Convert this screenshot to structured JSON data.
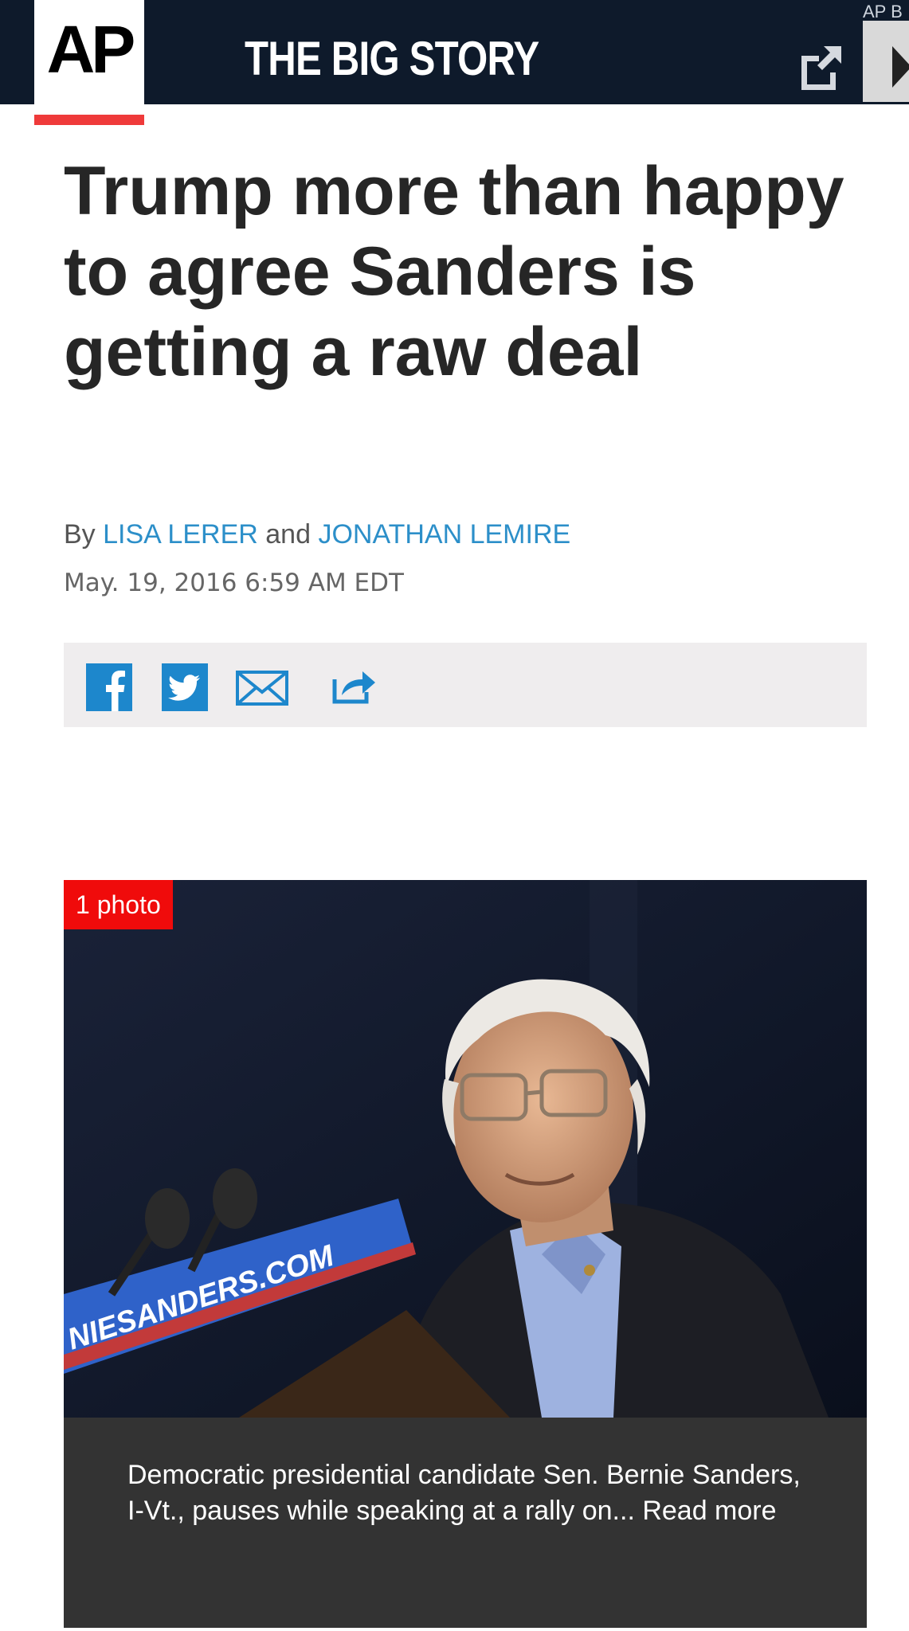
{
  "header": {
    "logo_text": "AP",
    "brand_title": "THE BIG STORY",
    "corner_text": "AP B",
    "external_link_icon": "external-link-icon",
    "play_icon": "play-icon"
  },
  "article": {
    "headline": "Trump more than happy to agree Sanders is getting a raw deal",
    "byline_prefix": "By",
    "authors": [
      "LISA LERER",
      "JONATHAN LEMIRE"
    ],
    "byline_joiner": "and",
    "date": "May. 19, 2016 6:59 AM EDT"
  },
  "share": {
    "icons": [
      "facebook-icon",
      "twitter-icon",
      "email-icon",
      "share-icon"
    ]
  },
  "photo": {
    "badge": "1 photo",
    "caption": "Democratic presidential candidate Sen. Bernie Sanders, I-Vt., pauses while speaking at a rally on... Read more",
    "podium_text": "NIESANDERS.COM"
  },
  "colors": {
    "header_bg": "#0e1a2b",
    "accent_red": "#ef3a3a",
    "link_blue": "#2c8fc9",
    "share_blue": "#1d87cc",
    "caption_bg": "#333333"
  }
}
